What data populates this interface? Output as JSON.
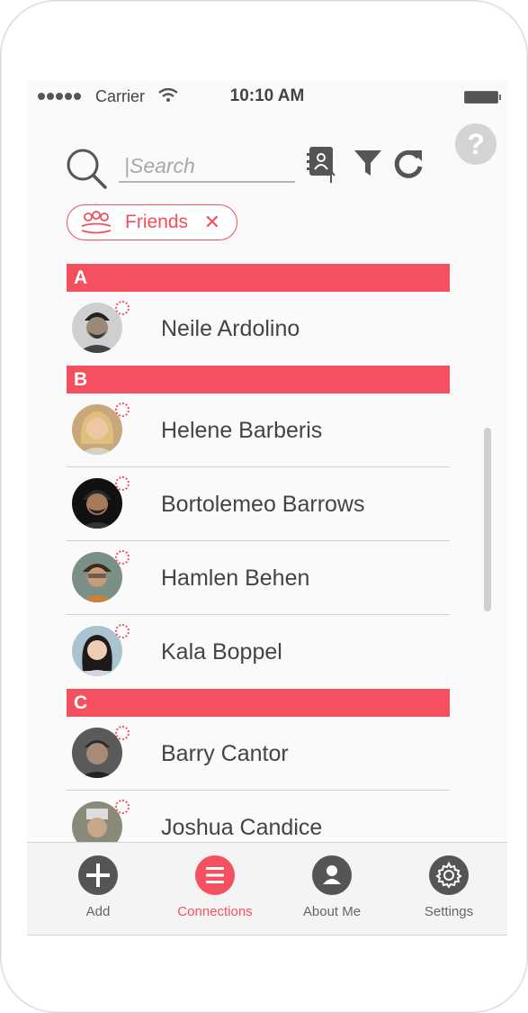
{
  "status_bar": {
    "carrier": "Carrier",
    "time": "10:10 AM"
  },
  "help": {
    "label": "?"
  },
  "search": {
    "placeholder": "|Search"
  },
  "filter_chip": {
    "label": "Friends",
    "remove": "✕"
  },
  "sections": [
    {
      "letter": "A",
      "contacts": [
        {
          "name": "Neile Ardolino"
        }
      ]
    },
    {
      "letter": "B",
      "contacts": [
        {
          "name": "Helene Barberis"
        },
        {
          "name": "Bortolemeo Barrows"
        },
        {
          "name": "Hamlen Behen"
        },
        {
          "name": "Kala Boppel"
        }
      ]
    },
    {
      "letter": "C",
      "contacts": [
        {
          "name": "Barry Cantor"
        },
        {
          "name": "Joshua Candice"
        }
      ]
    }
  ],
  "tabbar": {
    "add": "Add",
    "connections": "Connections",
    "about_me": "About Me",
    "settings": "Settings"
  },
  "colors": {
    "accent": "#f45060",
    "icon_dark": "#555555"
  }
}
